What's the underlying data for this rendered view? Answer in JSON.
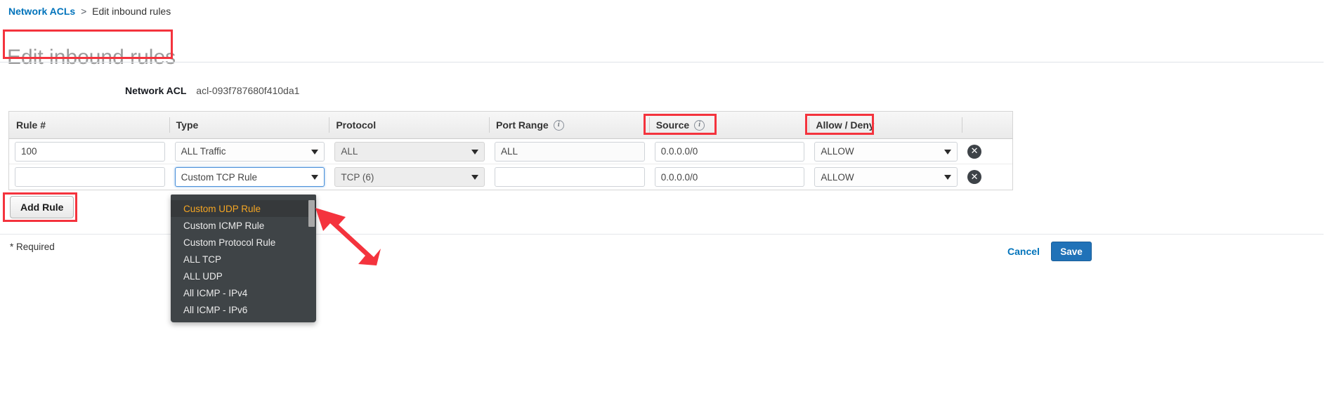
{
  "breadcrumb": {
    "parent": "Network ACLs",
    "separator": ">",
    "current": "Edit inbound rules"
  },
  "page_title": "Edit inbound rules",
  "acl": {
    "label": "Network ACL",
    "value": "acl-093f787680f410da1"
  },
  "table": {
    "headers": [
      {
        "label": "Rule #",
        "info": false
      },
      {
        "label": "Type",
        "info": false
      },
      {
        "label": "Protocol",
        "info": false
      },
      {
        "label": "Port Range",
        "info": true
      },
      {
        "label": "Source",
        "info": true
      },
      {
        "label": "Allow / Deny",
        "info": false
      }
    ],
    "info_glyph": "i",
    "rows": [
      {
        "rule_number": "100",
        "rule_number_placeholder": "",
        "type": "ALL Traffic",
        "protocol": "ALL",
        "port_range": "ALL",
        "source": "0.0.0.0/0",
        "allow_deny": "ALLOW",
        "delete_glyph": "✕"
      },
      {
        "rule_number": "",
        "rule_number_placeholder": "",
        "type": "Custom TCP Rule",
        "protocol": "TCP (6)",
        "port_range": "",
        "source": "0.0.0.0/0",
        "allow_deny": "ALLOW",
        "delete_glyph": "✕"
      }
    ]
  },
  "type_dropdown": {
    "open": true,
    "selected": "Custom UDP Rule",
    "options": [
      "Custom UDP Rule",
      "Custom ICMP Rule",
      "Custom Protocol Rule",
      "ALL TCP",
      "ALL UDP",
      "All ICMP - IPv4",
      "All ICMP - IPv6"
    ]
  },
  "buttons": {
    "add_rule": "Add Rule",
    "cancel": "Cancel",
    "save": "Save"
  },
  "footer": {
    "required_note": "* Required"
  },
  "colors": {
    "link": "#0073bb",
    "save_button": "#2072b8",
    "annotation": "#f4333d",
    "dropdown_bg": "#3f4447",
    "dropdown_selected_text": "#f5a623",
    "title_grey": "#9a9a9a"
  }
}
